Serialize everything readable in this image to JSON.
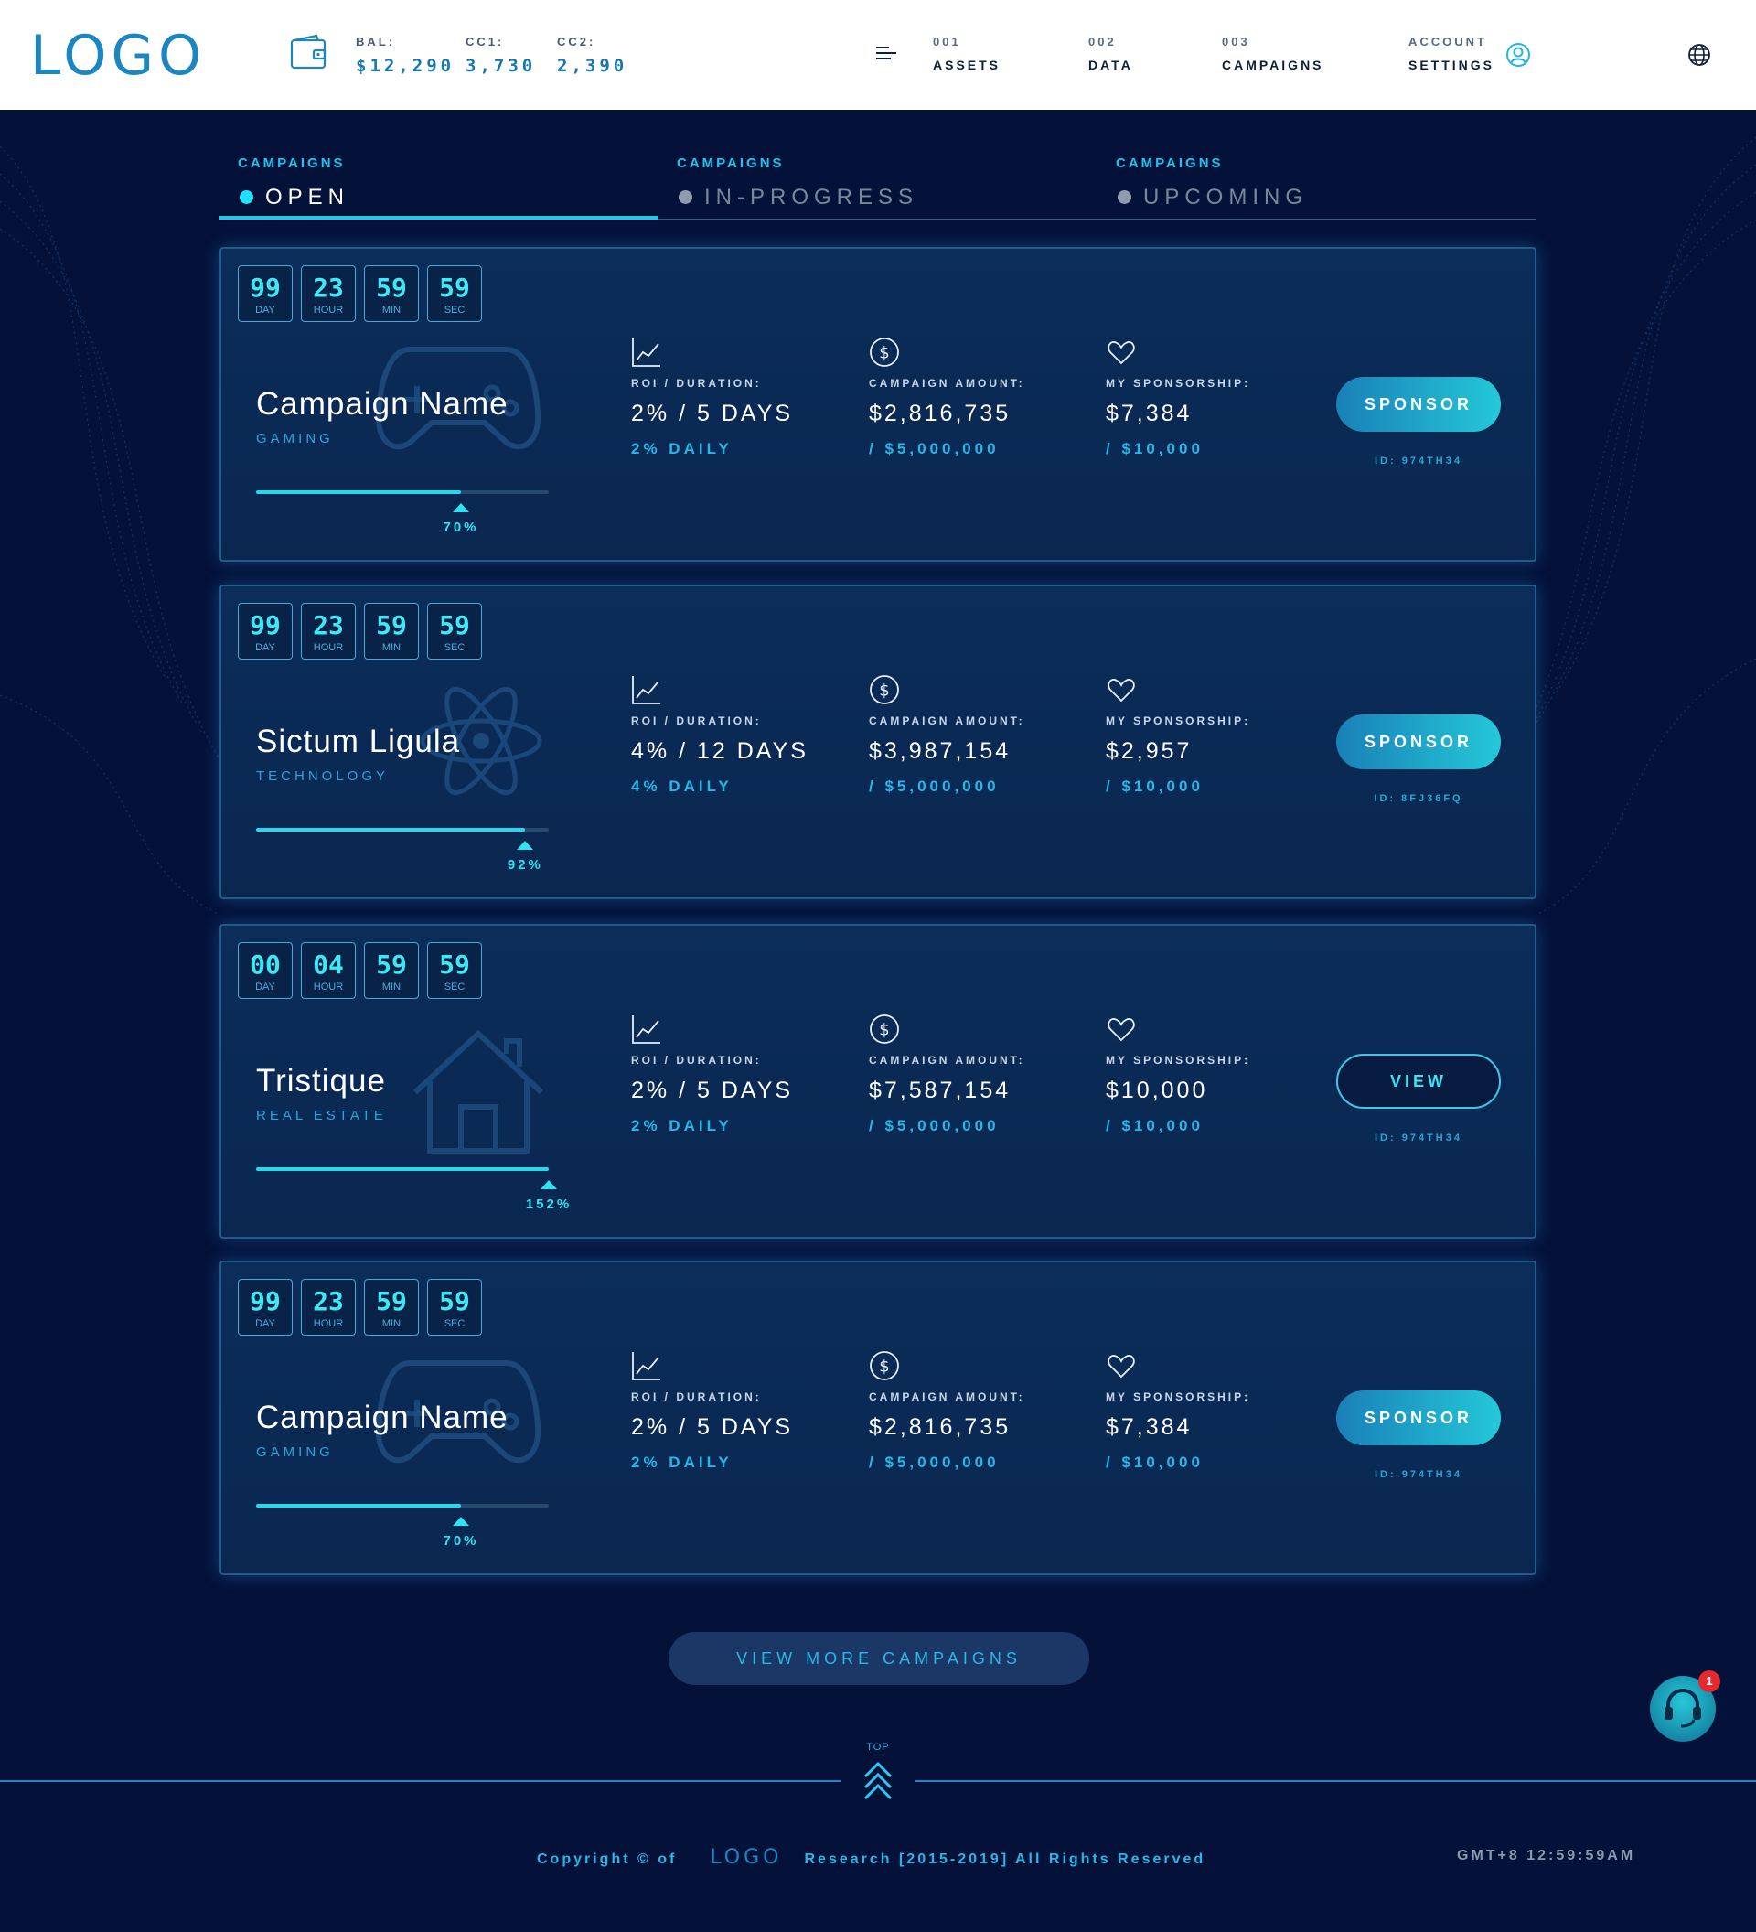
{
  "header": {
    "logo": "LOGO",
    "balances": [
      {
        "label": "BAL:",
        "value": "$12,290"
      },
      {
        "label": "CC1:",
        "value": "3,730"
      },
      {
        "label": "CC2:",
        "value": "2,390"
      }
    ],
    "nav": [
      {
        "num": "001",
        "label": "ASSETS"
      },
      {
        "num": "002",
        "label": "DATA"
      },
      {
        "num": "003",
        "label": "CAMPAIGNS"
      },
      {
        "num": "ACCOUNT",
        "label": "SETTINGS"
      }
    ]
  },
  "tabs": [
    {
      "category": "CAMPAIGNS",
      "label": "OPEN",
      "active": true
    },
    {
      "category": "CAMPAIGNS",
      "label": "IN-PROGRESS",
      "active": false
    },
    {
      "category": "CAMPAIGNS",
      "label": "UPCOMING",
      "active": false
    }
  ],
  "timer_units": {
    "day": "DAY",
    "hour": "HOUR",
    "min": "MIN",
    "sec": "SEC"
  },
  "labels": {
    "roi": "ROI / DURATION:",
    "amount": "CAMPAIGN AMOUNT:",
    "sponsorship": "MY SPONSORSHIP:"
  },
  "campaigns": [
    {
      "timer": {
        "day": "99",
        "hour": "23",
        "min": "59",
        "sec": "59"
      },
      "name": "Campaign Name",
      "category": "GAMING",
      "icon": "gamepad-icon",
      "progress": 70,
      "progress_label": "70%",
      "roi": "2% / 5 DAYS",
      "roi_daily": "2% DAILY",
      "amount": "$2,816,735",
      "amount_total": "/ $5,000,000",
      "sponsorship": "$7,384",
      "sponsorship_max": "/ $10,000",
      "action": "SPONSOR",
      "id": "ID: 974TH34"
    },
    {
      "timer": {
        "day": "99",
        "hour": "23",
        "min": "59",
        "sec": "59"
      },
      "name": "Sictum Ligula",
      "category": "TECHNOLOGY",
      "icon": "atom-icon",
      "progress": 92,
      "progress_label": "92%",
      "roi": "4% / 12 DAYS",
      "roi_daily": "4% DAILY",
      "amount": "$3,987,154",
      "amount_total": "/ $5,000,000",
      "sponsorship": "$2,957",
      "sponsorship_max": "/ $10,000",
      "action": "SPONSOR",
      "id": "ID: 8FJ36FQ"
    },
    {
      "timer": {
        "day": "00",
        "hour": "04",
        "min": "59",
        "sec": "59"
      },
      "name": "Tristique",
      "category": "REAL ESTATE",
      "icon": "house-icon",
      "progress": 152,
      "progress_label": "152%",
      "roi": "2% / 5 DAYS",
      "roi_daily": "2% DAILY",
      "amount": "$7,587,154",
      "amount_total": "/ $5,000,000",
      "sponsorship": "$10,000",
      "sponsorship_max": "/ $10,000",
      "action": "VIEW",
      "id": "ID: 974TH34"
    },
    {
      "timer": {
        "day": "99",
        "hour": "23",
        "min": "59",
        "sec": "59"
      },
      "name": "Campaign Name",
      "category": "GAMING",
      "icon": "gamepad-icon",
      "progress": 70,
      "progress_label": "70%",
      "roi": "2% / 5 DAYS",
      "roi_daily": "2% DAILY",
      "amount": "$2,816,735",
      "amount_total": "/ $5,000,000",
      "sponsorship": "$7,384",
      "sponsorship_max": "/ $10,000",
      "action": "SPONSOR",
      "id": "ID: 974TH34"
    }
  ],
  "more_button": "VIEW MORE CAMPAIGNS",
  "support_badge": "1",
  "top_label": "TOP",
  "footer": {
    "copyright_pre": "Copyright © of",
    "logo": "LOGO",
    "copyright_post": "Research [2015-2019] All Rights Reserved",
    "clock": "GMT+8 12:59:59AM"
  },
  "colors": {
    "accent": "#25c6e6",
    "brand": "#1b86bf",
    "background": "#04123a",
    "card": "#0b2d5a"
  }
}
